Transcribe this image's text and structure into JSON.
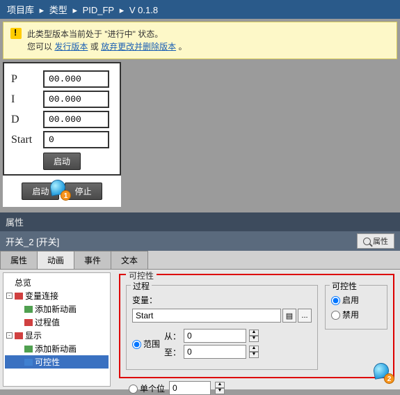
{
  "breadcrumb": {
    "items": [
      "项目库",
      "类型",
      "PID_FP",
      "V 0.1.8"
    ],
    "sep": "▸"
  },
  "notice": {
    "line1": "此类型版本当前处于 \"进行中\" 状态。",
    "prefix": "您可以",
    "link1": "发行版本",
    "mid": "或",
    "link2": "放弃更改并删除版本",
    "suffix": "。"
  },
  "pid": {
    "rows": [
      {
        "label": "P",
        "value": "00.000"
      },
      {
        "label": "I",
        "value": "00.000"
      },
      {
        "label": "D",
        "value": "00.000"
      },
      {
        "label": "Start",
        "value": "0"
      }
    ],
    "btn_center": "启动",
    "btn_start": "启动",
    "btn_stop": "停止",
    "cursor1_num": "1",
    "cursor2_num": "2"
  },
  "prop": {
    "title": "属性",
    "obj": "开关_2 [开关]",
    "rtab": "属性",
    "tabs": [
      "属性",
      "动画",
      "事件",
      "文本"
    ],
    "active_tab": 1
  },
  "tree": {
    "n0": "总览",
    "n1": "变量连接",
    "n1a": "添加新动画",
    "n1b": "过程值",
    "n2": "显示",
    "n2a": "添加新动画",
    "n2b": "可控性"
  },
  "form": {
    "fs_title": "可控性",
    "proc_title": "过程",
    "var_label": "变量：",
    "var_value": "Start",
    "dots": "...",
    "range_label": "范围",
    "from_label": "从：",
    "from_val": "0",
    "to_label": "至：",
    "to_val": "0",
    "single_label": "单个位",
    "single_val": "0",
    "ctrl_title": "可控性",
    "enable": "启用",
    "disable": "禁用"
  }
}
